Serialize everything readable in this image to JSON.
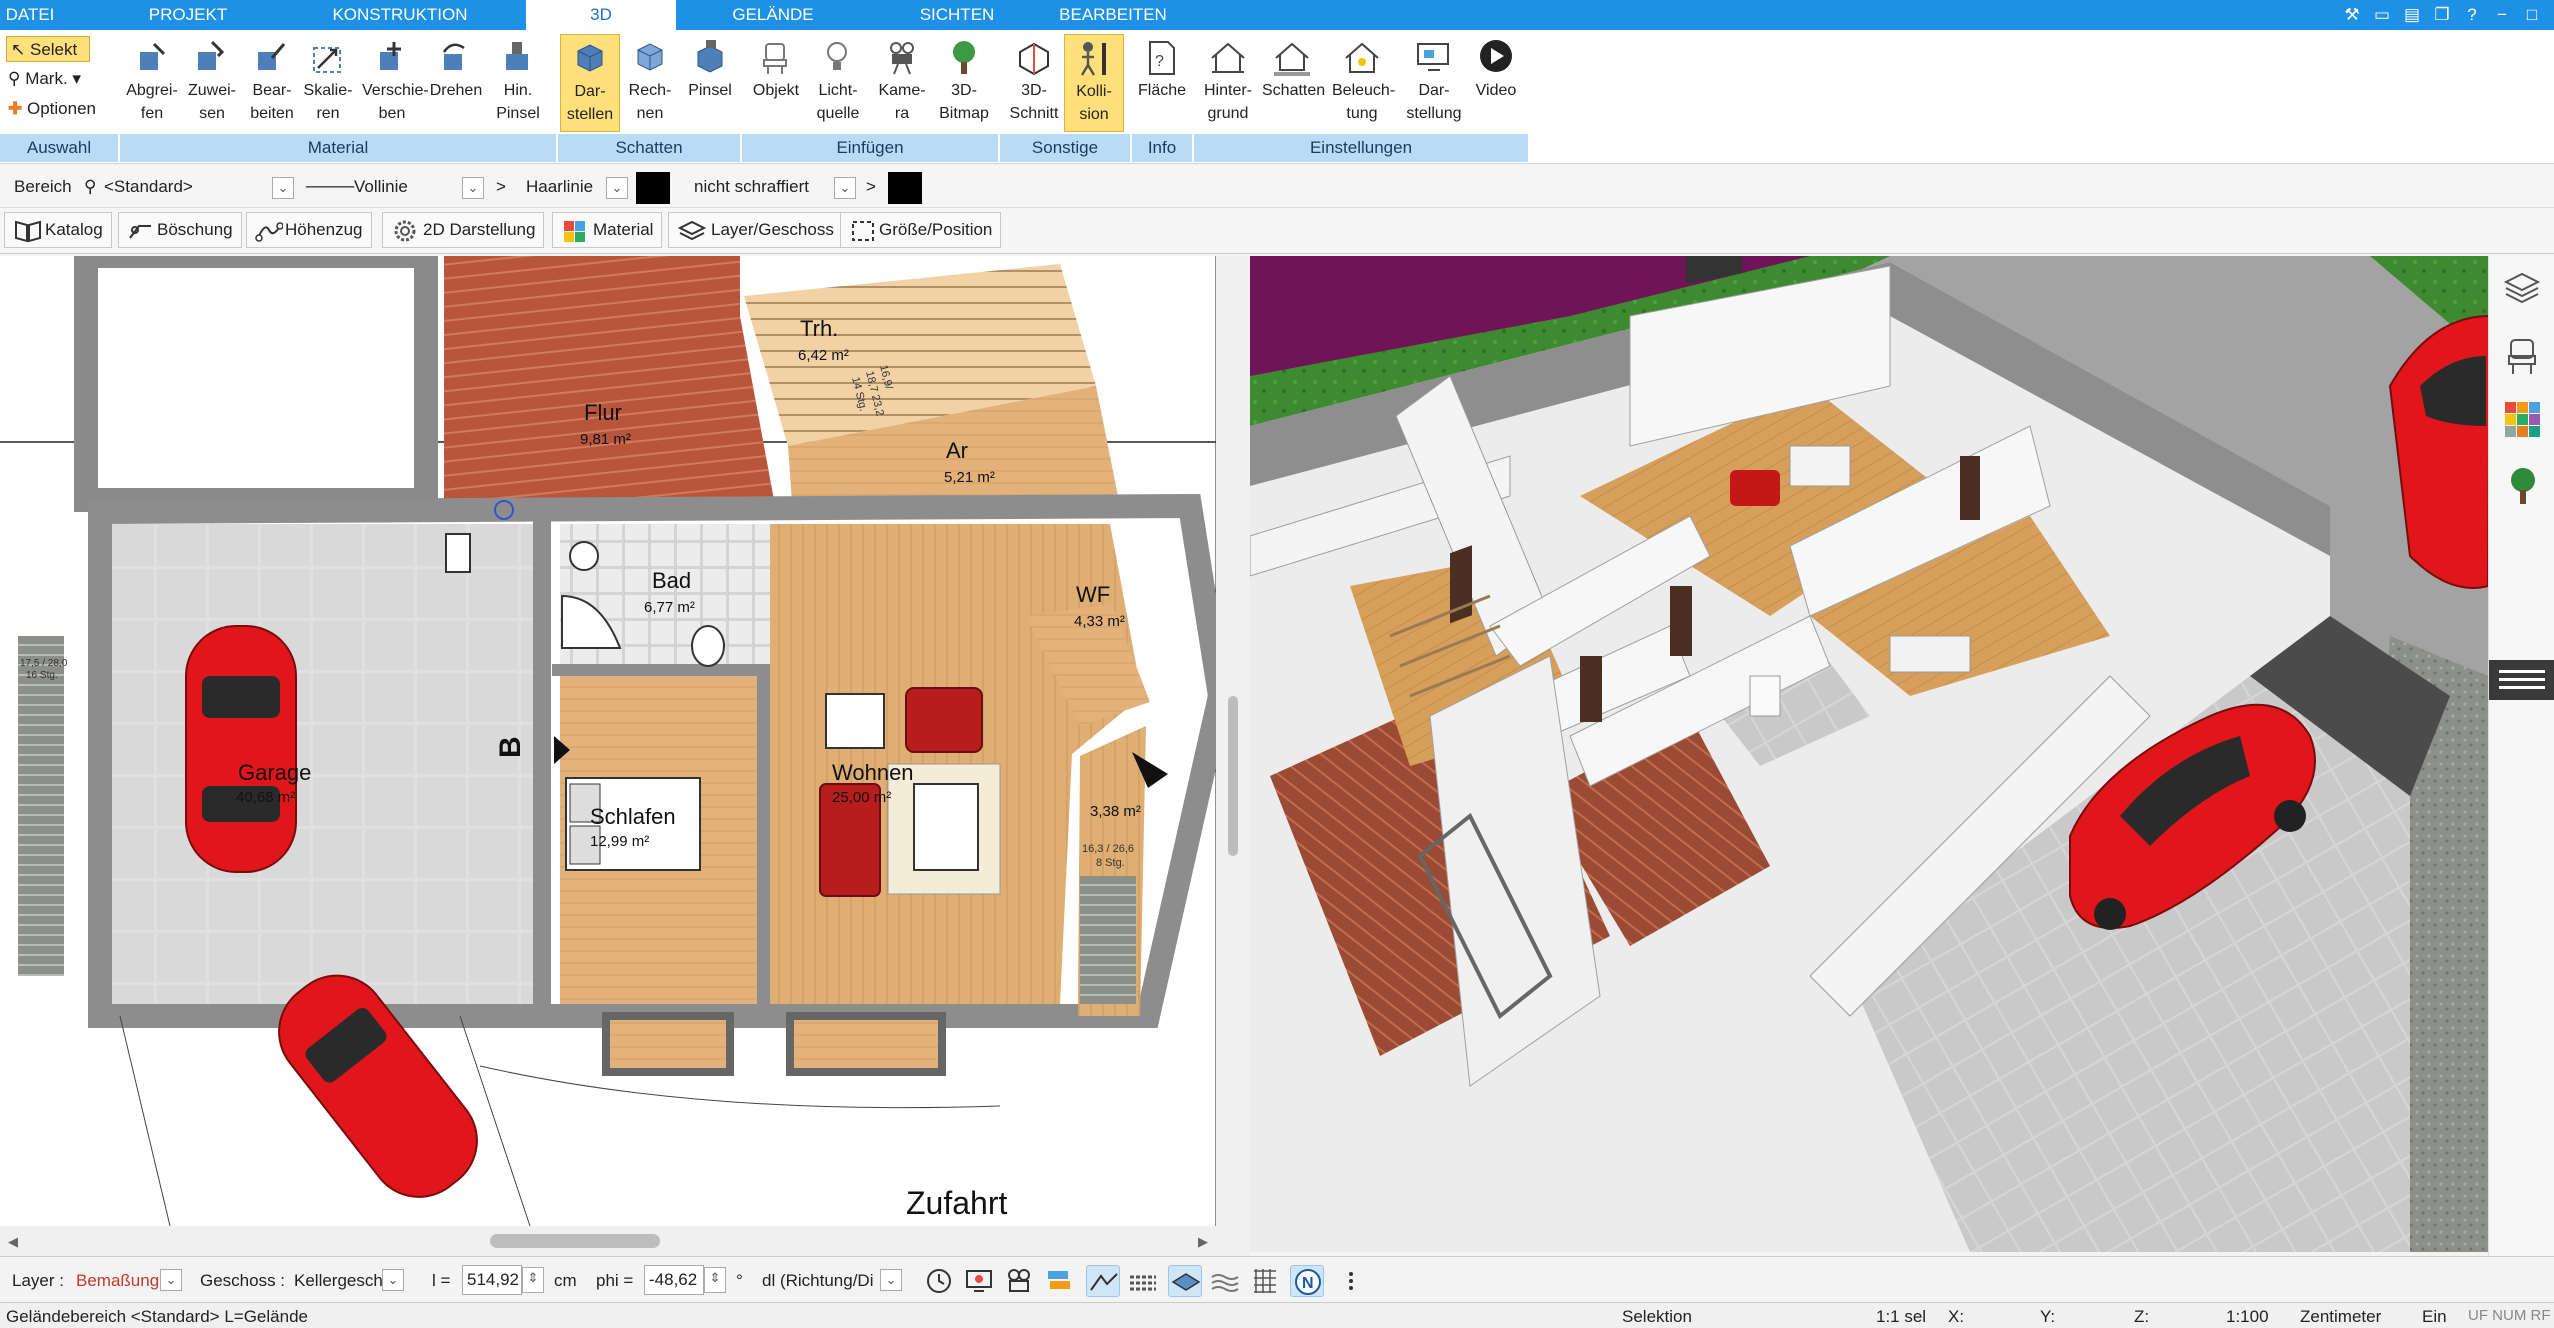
{
  "menu_tabs": [
    "DATEI",
    "PROJEKT",
    "KONSTRUKTION",
    "3D",
    "GELÄNDE",
    "SICHTEN",
    "BEARBEITEN"
  ],
  "active_tab": "3D",
  "ribbon": {
    "auswahl": {
      "label": "Auswahl",
      "items": [
        "Selekt",
        "Mark.",
        "Optionen"
      ]
    },
    "material": {
      "label": "Material",
      "buttons": [
        [
          "Abgrei-",
          "fen"
        ],
        [
          "Zuwei-",
          "sen"
        ],
        [
          "Bear-",
          "beiten"
        ],
        [
          "Skalie-",
          "ren"
        ],
        [
          "Verschie-",
          "ben"
        ],
        [
          "Drehen",
          ""
        ],
        [
          "Hin.",
          "Pinsel"
        ]
      ]
    },
    "schatten": {
      "label": "Schatten",
      "buttons": [
        [
          "Dar-",
          "stellen"
        ],
        [
          "Rech-",
          "nen"
        ],
        [
          "Pinsel",
          ""
        ]
      ]
    },
    "einfuegen": {
      "label": "Einfügen",
      "buttons": [
        [
          "Objekt",
          ""
        ],
        [
          "Licht-",
          "quelle"
        ],
        [
          "Kame-",
          "ra"
        ],
        [
          "3D-",
          "Bitmap"
        ]
      ]
    },
    "sonstige": {
      "label": "Sonstige",
      "buttons": [
        [
          "3D-",
          "Schnitt"
        ],
        [
          "Kolli-",
          "sion"
        ]
      ]
    },
    "info": {
      "label": "Info",
      "buttons": [
        [
          "Fläche",
          ""
        ]
      ]
    },
    "einstellungen": {
      "label": "Einstellungen",
      "buttons": [
        [
          "Hinter-",
          "grund"
        ],
        [
          "Schatten",
          ""
        ],
        [
          "Beleuch-",
          "tung"
        ],
        [
          "Dar-",
          "stellung"
        ],
        [
          "Video",
          ""
        ]
      ]
    }
  },
  "propbar": {
    "bereich_label": "Bereich",
    "bereich_value": "<Standard>",
    "line_style": "Vollinie",
    "line_weight": "Haarlinie",
    "hatch": "nicht schraffiert"
  },
  "toolbar2": [
    "Katalog",
    "Böschung",
    "Höhenzug",
    "2D Darstellung",
    "Material",
    "Layer/Geschoss",
    "Größe/Position"
  ],
  "plan": {
    "rooms": [
      {
        "name": "Flur",
        "area": "9,81 m²"
      },
      {
        "name": "Trh.",
        "area": "6,42 m²"
      },
      {
        "name": "Ar",
        "area": "5,21 m²"
      },
      {
        "name": "Bad",
        "area": "6,77 m²"
      },
      {
        "name": "WF",
        "area": "4,33 m²"
      },
      {
        "name": "Garage",
        "area": "40,68 m²"
      },
      {
        "name": "Wohnen",
        "area": "25,00 m²"
      },
      {
        "name": "Schlafen",
        "area": "12,99 m²"
      },
      {
        "name": "",
        "area": "3,38 m²"
      }
    ],
    "stair1": [
      "16,9/",
      "18,7 23,2",
      "14 Stg."
    ],
    "stair2": [
      "16,3 / 26,6",
      "8 Stg."
    ],
    "stair3": [
      "17,5 / 28,0",
      "16 Stg."
    ],
    "section_marker": "B",
    "road_label": "Zufahrt"
  },
  "bottombar": {
    "layer_label": "Layer :",
    "layer_value": "Bemaßung",
    "geschoss_label": "Geschoss :",
    "geschoss_value": "Kellergesch",
    "l_label": "l =",
    "l_value": "514,92",
    "l_unit": "cm",
    "phi_label": "phi =",
    "phi_value": "-48,62",
    "phi_unit": "°",
    "dl_value": "dl (Richtung/Di"
  },
  "statusbar": {
    "left": "Geländebereich <Standard> L=Gelände",
    "mode": "Selektion",
    "sel": "1:1 sel",
    "x": "X:",
    "y": "Y:",
    "z": "Z:",
    "scale": "1:100",
    "unit": "Zentimeter",
    "ein": "Ein",
    "flags": "UF NUM RF"
  },
  "colors": {
    "menubar": "#1e90e6",
    "group_label": "#b8dcf7",
    "highlight": "#ffe07a",
    "wood": "#d9a05b",
    "floor_red": "#a0513b",
    "car": "#e0161b",
    "purple": "#6f1456",
    "grass": "#3d8a30"
  }
}
